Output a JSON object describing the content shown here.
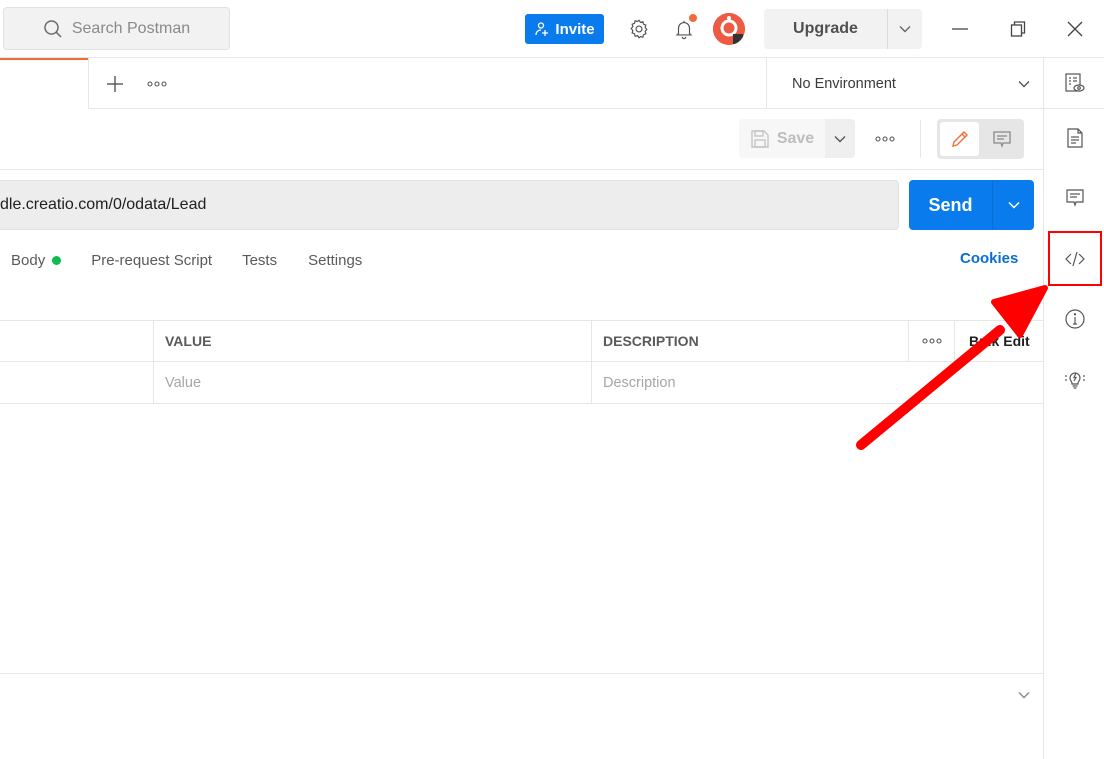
{
  "titlebar": {
    "search_placeholder": "Search Postman",
    "invite_label": "Invite",
    "upgrade_label": "Upgrade",
    "notification_badge": true,
    "colors": {
      "primary": "#097bed",
      "accent": "#f26b3a"
    }
  },
  "tabbar": {
    "new_tab_icon": "plus-icon",
    "more_icon": "more-horizontal-icon",
    "environment": {
      "selected": "No Environment"
    }
  },
  "request": {
    "save_label": "Save",
    "url": "dle.creatio.com/0/odata/Lead",
    "send_label": "Send",
    "tabs": [
      {
        "label": "Body",
        "has_indicator": true
      },
      {
        "label": "Pre-request Script"
      },
      {
        "label": "Tests"
      },
      {
        "label": "Settings"
      }
    ],
    "cookies_label": "Cookies"
  },
  "params_table": {
    "headers": {
      "value": "VALUE",
      "description": "DESCRIPTION",
      "bulk_edit": "Bulk Edit"
    },
    "placeholder_row": {
      "key": "",
      "value": "Value",
      "description": "Description"
    }
  },
  "right_sidebar": {
    "items": [
      {
        "name": "environment-quick-look",
        "icon": "environment-eye-icon"
      },
      {
        "name": "documentation",
        "icon": "document-icon"
      },
      {
        "name": "comments",
        "icon": "comment-icon"
      },
      {
        "name": "code-snippet",
        "icon": "code-icon",
        "highlighted": true
      },
      {
        "name": "info",
        "icon": "info-icon"
      },
      {
        "name": "related",
        "icon": "lightbulb-icon"
      }
    ]
  },
  "annotation": {
    "type": "arrow",
    "color": "#ff0000",
    "target": "code-snippet"
  }
}
